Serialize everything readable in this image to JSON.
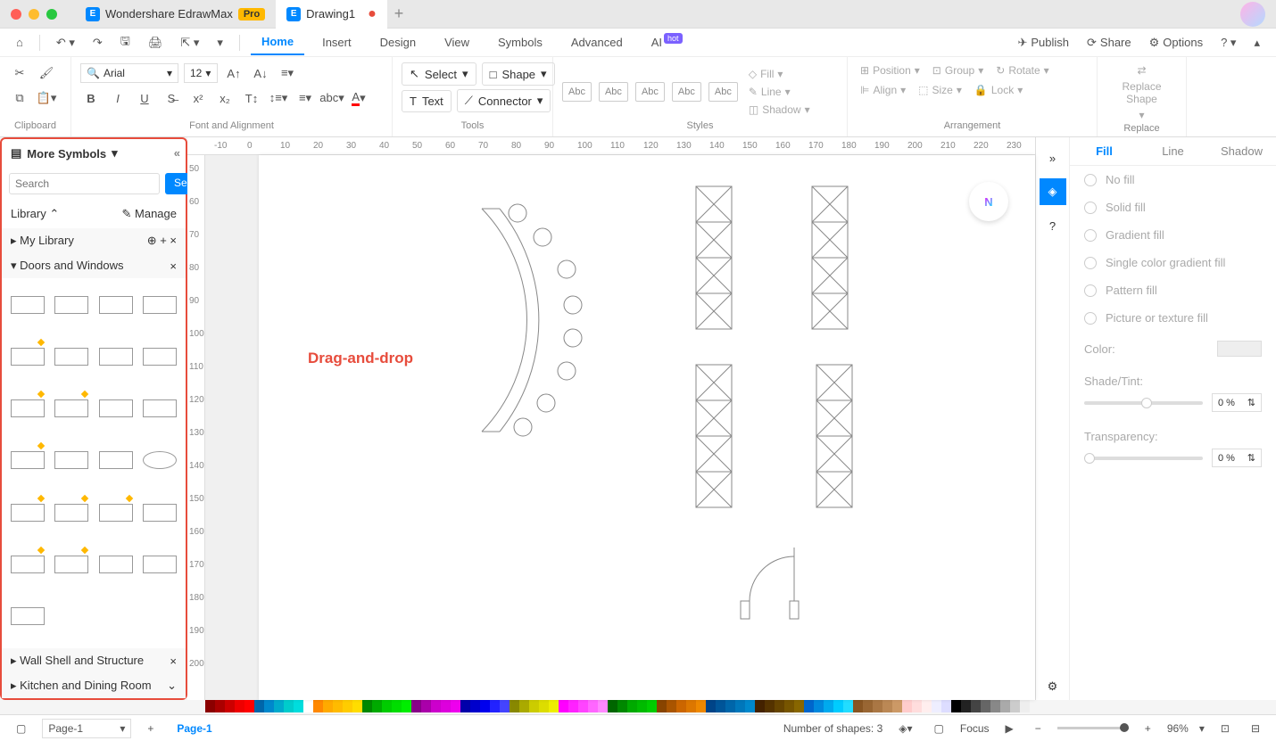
{
  "titlebar": {
    "app_name": "Wondershare EdrawMax",
    "pro_badge": "Pro",
    "doc_name": "Drawing1"
  },
  "menubar": {
    "items": [
      "Home",
      "Insert",
      "Design",
      "View",
      "Symbols",
      "Advanced",
      "AI"
    ],
    "active": "Home",
    "hot_badge": "hot",
    "publish": "Publish",
    "share": "Share",
    "options": "Options"
  },
  "ribbon": {
    "clipboard_label": "Clipboard",
    "font_label": "Font and Alignment",
    "tools_label": "Tools",
    "styles_label": "Styles",
    "arrangement_label": "Arrangement",
    "replace_label": "Replace",
    "font_name": "Arial",
    "font_size": "12",
    "select": "Select",
    "shape": "Shape",
    "text": "Text",
    "connector": "Connector",
    "abc": "Abc",
    "fill": "Fill",
    "line": "Line",
    "shadow": "Shadow",
    "position": "Position",
    "group": "Group",
    "rotate": "Rotate",
    "align": "Align",
    "size": "Size",
    "lock": "Lock",
    "replace_shape": "Replace\nShape"
  },
  "left": {
    "title": "More Symbols",
    "search_placeholder": "Search",
    "search_btn": "Search",
    "library": "Library",
    "manage": "Manage",
    "my_library": "My Library",
    "section1": "Doors and Windows",
    "section2": "Wall Shell and Structure",
    "section3": "Kitchen and Dining Room"
  },
  "canvas": {
    "drag_label": "Drag-and-drop",
    "ruler_h": [
      "-10",
      "0",
      "10",
      "20",
      "30",
      "40",
      "50",
      "60",
      "70",
      "80",
      "90",
      "100",
      "110",
      "120",
      "130",
      "140",
      "150",
      "160",
      "170",
      "180",
      "190",
      "200",
      "210",
      "220",
      "230"
    ],
    "ruler_v": [
      "50",
      "60",
      "70",
      "80",
      "90",
      "100",
      "110",
      "120",
      "130",
      "140",
      "150",
      "160",
      "170",
      "180",
      "190",
      "200"
    ]
  },
  "right": {
    "tabs": [
      "Fill",
      "Line",
      "Shadow"
    ],
    "active_tab": "Fill",
    "no_fill": "No fill",
    "solid_fill": "Solid fill",
    "gradient_fill": "Gradient fill",
    "single_gradient": "Single color gradient fill",
    "pattern_fill": "Pattern fill",
    "picture_fill": "Picture or texture fill",
    "color": "Color:",
    "shade_tint": "Shade/Tint:",
    "transparency": "Transparency:",
    "zero_percent": "0 %"
  },
  "status": {
    "page_select": "Page-1",
    "page_tab": "Page-1",
    "shapes": "Number of shapes: 3",
    "focus": "Focus",
    "zoom": "96%"
  },
  "colors": [
    "#8b0000",
    "#a00",
    "#c00",
    "#e00",
    "#f00",
    "#06a",
    "#08c",
    "#0ac",
    "#0cc",
    "#0dd",
    "#fff",
    "#f80",
    "#fa0",
    "#fb0",
    "#fc0",
    "#fd0",
    "#080",
    "#0a0",
    "#0c0",
    "#0d0",
    "#0e0",
    "#808",
    "#a0a",
    "#c0c",
    "#d0d",
    "#e0e",
    "#00a",
    "#00c",
    "#00e",
    "#22f",
    "#44f",
    "#880",
    "#aa0",
    "#cc0",
    "#dd0",
    "#ee0",
    "#f0f",
    "#f2f",
    "#f4f",
    "#f6f",
    "#f8f",
    "#060",
    "#080",
    "#0a0",
    "#0b0",
    "#0c0",
    "#840",
    "#a50",
    "#c60",
    "#d70",
    "#e80",
    "#048",
    "#059",
    "#06a",
    "#07b",
    "#08c",
    "#420",
    "#530",
    "#640",
    "#750",
    "#860",
    "#06c",
    "#08d",
    "#0ae",
    "#0cf",
    "#2df",
    "#852",
    "#963",
    "#a74",
    "#b85",
    "#c96",
    "#fcc",
    "#fdd",
    "#fee",
    "#eef",
    "#ddf",
    "#000",
    "#222",
    "#444",
    "#666",
    "#888",
    "#aaa",
    "#ccc",
    "#eee"
  ]
}
